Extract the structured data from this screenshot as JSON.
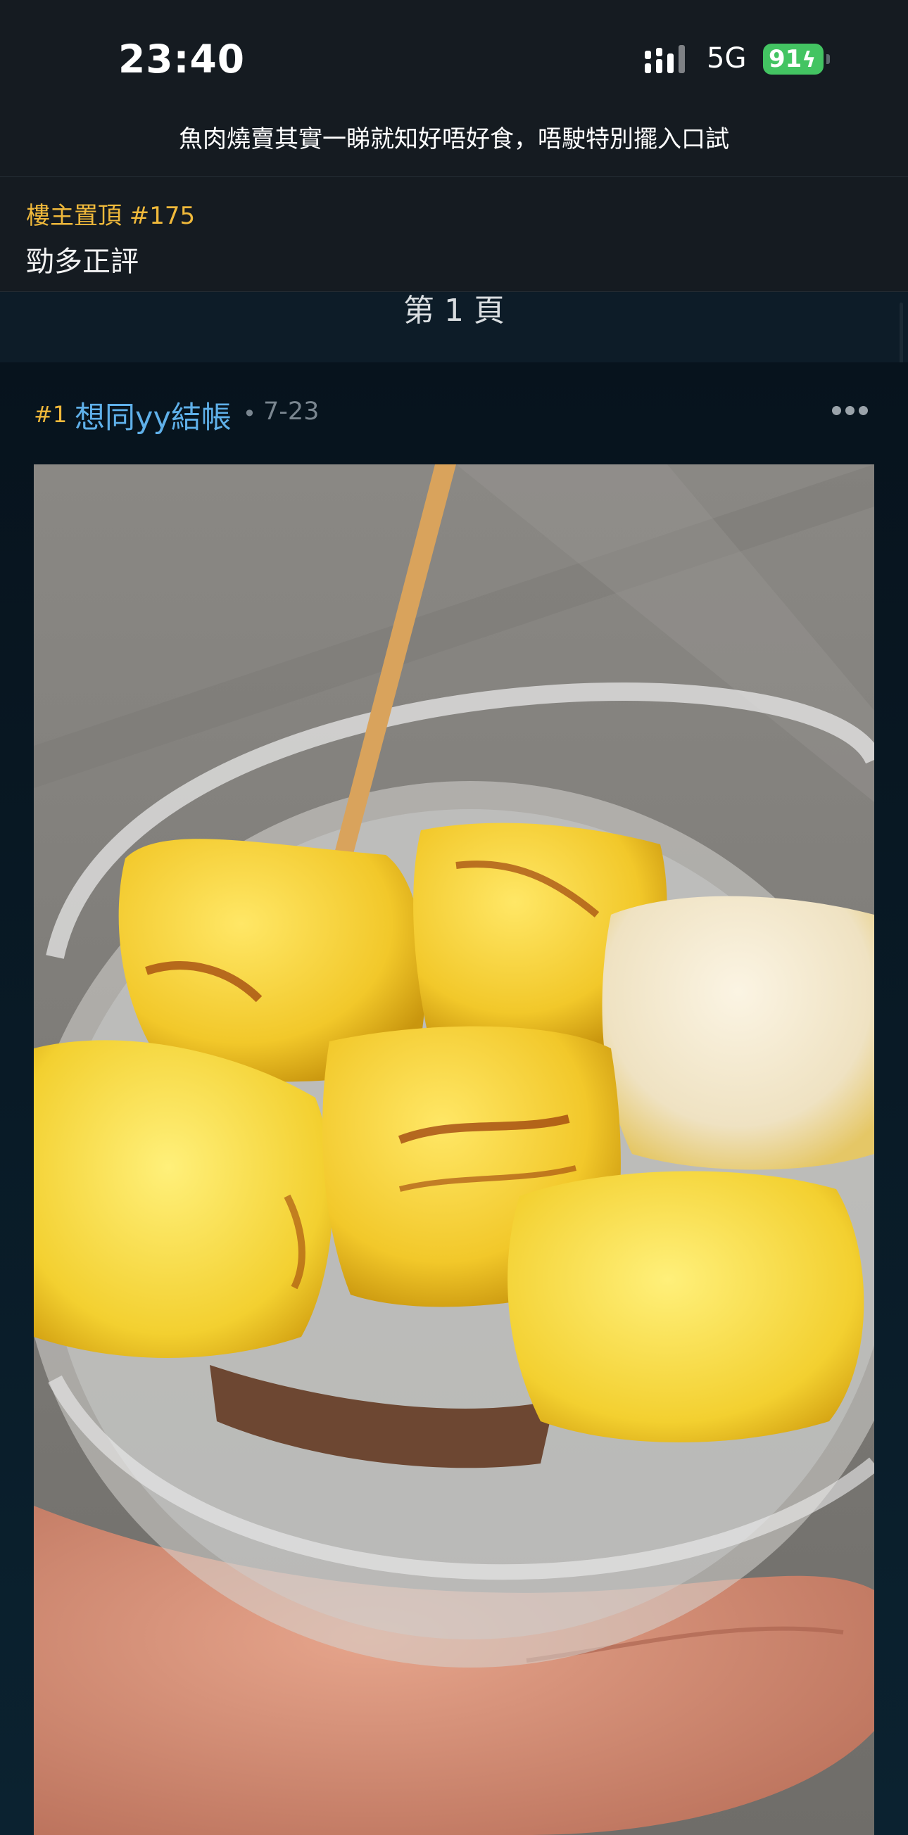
{
  "status_bar": {
    "time": "23:40",
    "network": "5G",
    "battery": "91",
    "battery_charging": true,
    "signal_icon": "cellular-signal-icon",
    "battery_color": "#43c462"
  },
  "thread": {
    "title": "魚肉燒賣其實一睇就知好唔好食，唔駛特別擺入口試"
  },
  "pinned": {
    "label": "樓主置頂 #175",
    "text": "勁多正評",
    "label_color": "#f0b93b"
  },
  "page": {
    "label": "第 1 頁"
  },
  "post": {
    "floor": "#1",
    "username": "想同yy結帳",
    "separator": "•",
    "date": "7-23",
    "more_icon": "more-options-icon",
    "username_color": "#5fb0e9"
  }
}
